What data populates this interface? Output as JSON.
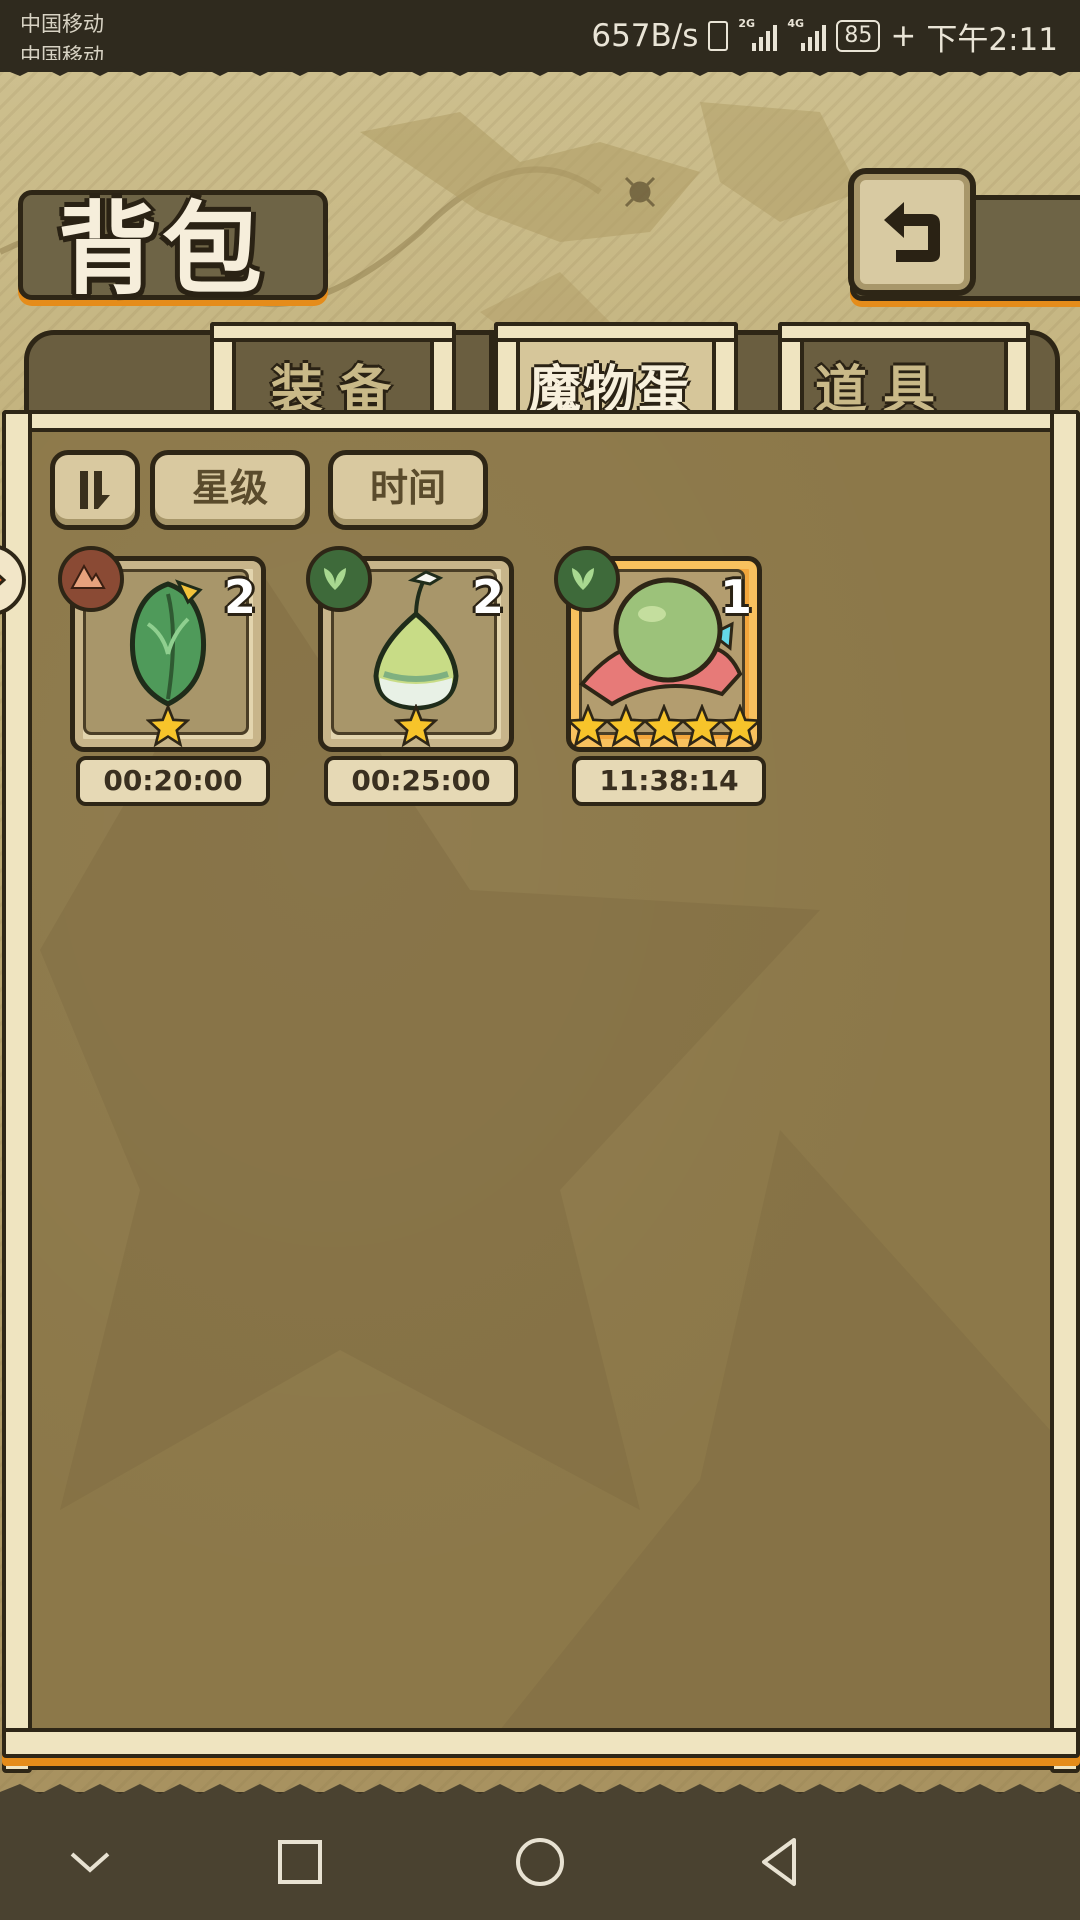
{
  "status_bar": {
    "carrier_1": "中国移动",
    "carrier_2": "中国移动",
    "net_speed": "657B/s",
    "sig1_label": "2G",
    "sig2_label": "4G",
    "battery": "85",
    "time": "下午2:11"
  },
  "header": {
    "title": "背包",
    "back_icon": "return-arrow-icon"
  },
  "tabs": [
    {
      "label": "装备",
      "active": false
    },
    {
      "label": "魔物蛋",
      "active": true
    },
    {
      "label": "道具",
      "active": false
    }
  ],
  "filters": {
    "toggle_icon": "sort-toggle-icon",
    "star_label": "星级",
    "time_label": "时间"
  },
  "eggs": [
    {
      "count": "2",
      "stars": 1,
      "element": "earth",
      "timer": "00:20:00",
      "name_icon": "leaf-egg-icon"
    },
    {
      "count": "2",
      "stars": 1,
      "element": "grass",
      "timer": "00:25:00",
      "name_icon": "bulb-egg-icon"
    },
    {
      "count": "1",
      "stars": 5,
      "element": "grass",
      "timer": "11:38:14",
      "name_icon": "green-egg-icon"
    }
  ],
  "colors": {
    "accent_orange": "#e58c1a",
    "panel": "#8c7849",
    "frame": "#efe4c0"
  }
}
